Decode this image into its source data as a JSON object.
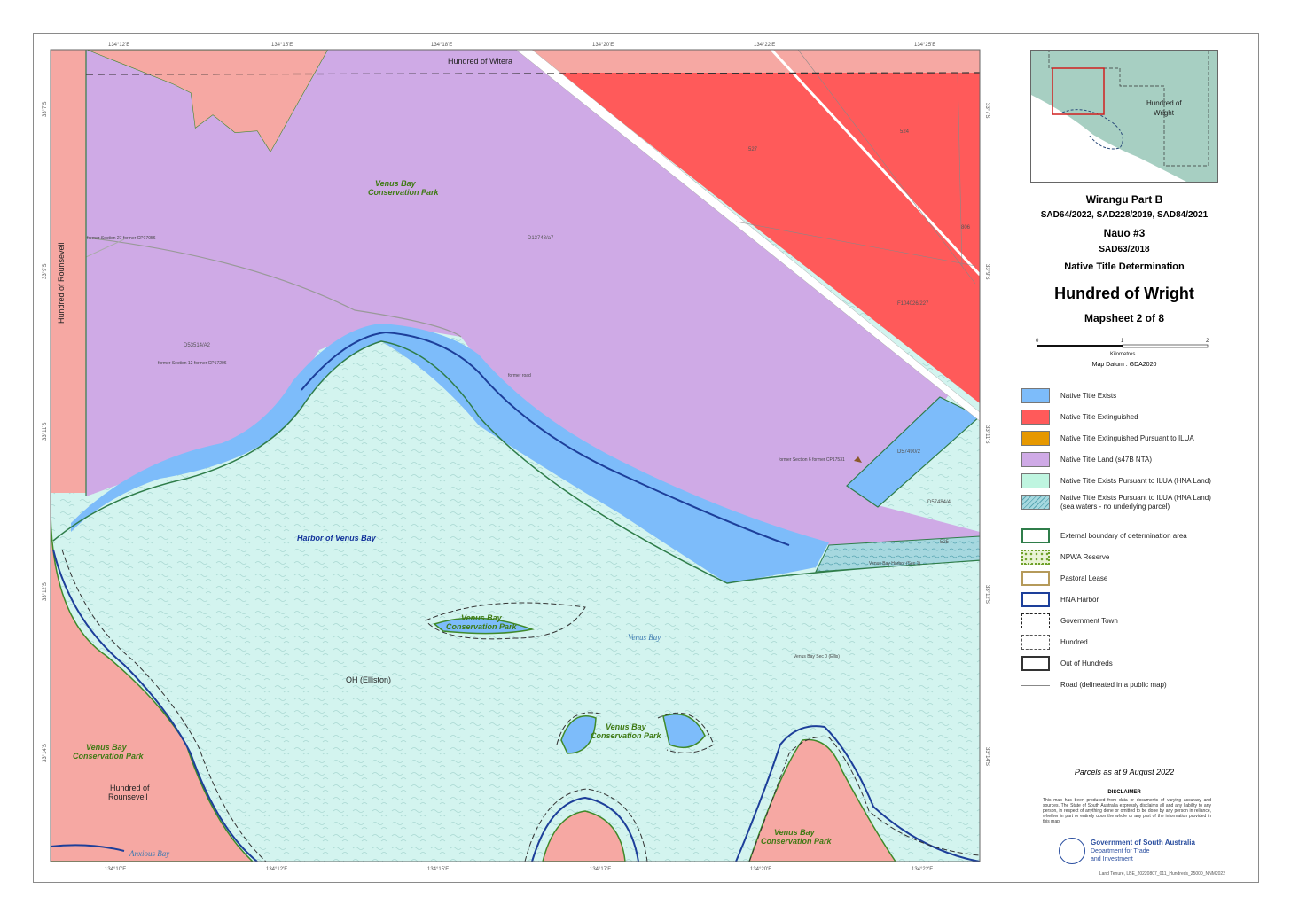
{
  "map": {
    "ticks_top": [
      "134°12'E",
      "134°15'E",
      "134°18'E",
      "134°20'E",
      "134°22'E",
      "134°25'E"
    ],
    "ticks_bottom": [
      "134°10'E",
      "134°12'E",
      "134°15'E",
      "134°17'E",
      "134°20'E",
      "134°22'E"
    ],
    "ticks_left": [
      "33°7'S",
      "33°9'S",
      "33°11'S",
      "33°12'S",
      "33°14'S"
    ],
    "ticks_right": [
      "33°7'S",
      "33°9'S",
      "33°11'S",
      "33°12'S",
      "33°14'S"
    ],
    "labels": {
      "hundred_witera": "Hundred of Witera",
      "hundred_rounsevell_vertical": "Hundred of Rounsevell",
      "hundred_rounsevell_bottom_1": "Hundred of",
      "hundred_rounsevell_bottom_2": "Rounsevell",
      "park_1a": "Venus Bay",
      "park_1b": "Conservation Park",
      "park_2a": "Venus Bay",
      "park_2b": "Conservation Park",
      "park_3a": "Venus Bay",
      "park_3b": "Conservation Park",
      "park_4a": "Venus Bay",
      "park_4b": "Conservation Park",
      "park_5a": "Venus Bay",
      "park_5b": "Conservation Park",
      "harbor": "Harbor of Venus Bay",
      "venus_bay_water": "Venus Bay",
      "anxious_bay": "Anxious Bay",
      "oh_elliston": "OH (Elliston)",
      "parcel_d53514": "D53514/A2",
      "parcel_d53514_note": "former Section 12 former CP17206",
      "parcel_d13748": "D13748/a7",
      "former_section": "former Section 27 former CP17056",
      "parcel_527": "527",
      "parcel_524": "524",
      "parcel_806": "806",
      "parcel_f104026": "F104026/227",
      "parcel_d57490": "D57490/2",
      "parcel_d57484": "D57484/4",
      "parcel_525": "525",
      "road_note": "former road",
      "former_section_right": "former Section 6 former CP17531",
      "venus_bay_sec": "Venus Bay Sec 0 (Ellis)",
      "sea_label": "Venus Bay Harbor (Sec 1)"
    }
  },
  "inset": {
    "label_1": "Hundred of",
    "label_2": "Wright"
  },
  "panel": {
    "title_1": "Wirangu Part B",
    "title_2": "SAD64/2022, SAD228/2019, SAD84/2021",
    "title_3": "Nauo #3",
    "title_4": "SAD63/2018",
    "title_5": "Native Title Determination",
    "main_title": "Hundred of Wright",
    "mapsheet": "Mapsheet 2 of 8",
    "scale_0": "0",
    "scale_1": "1",
    "scale_2": "2",
    "scale_unit": "Kilometres",
    "datum": "Map Datum : GDA2020",
    "parcels_date": "Parcels as at 9 August 2022",
    "disclaimer_title": "DISCLAIMER",
    "disclaimer_text": "This map has been produced from data or documents of varying accuracy and sources. The State of South Australia expressly disclaims all and any liability to any person, in respect of anything done or omitted to be done by any person in reliance, whether in part or entirely upon the whole or any part of the information provided in this map.",
    "gov_1": "Government of South Australia",
    "gov_2": "Department for Trade",
    "gov_3": "and Investment",
    "filename": "Land Tenure, LBE_20220807_011_Hundreds_25000_NNM2022"
  },
  "legend": [
    {
      "label": "Native Title Exists",
      "color": "#7dbcfa",
      "style": "fill"
    },
    {
      "label": "Native Title Extinguished",
      "color": "#ff5a5a",
      "style": "fill"
    },
    {
      "label": "Native Title Extinguished Pursuant to ILUA",
      "color": "#e69800",
      "style": "fill"
    },
    {
      "label": "Native Title Land (s47B NTA)",
      "color": "#cfaae6",
      "style": "fill"
    },
    {
      "label": "Native Title Exists Pursuant to ILUA (HNA Land)",
      "color": "#bff5e0",
      "style": "fill"
    },
    {
      "label": "Native Title Exists Pursuant to ILUA (HNA Land)",
      "label_2": "(sea waters - no underlying parcel)",
      "color": "#a6d8df",
      "style": "pattern"
    },
    {
      "label": "External boundary of determination area",
      "color": "#2f7d4a",
      "style": "outline"
    },
    {
      "label": "NPWA Reserve",
      "color": "#6fa12a",
      "style": "dotted"
    },
    {
      "label": "Pastoral Lease",
      "color": "#b59a5a",
      "style": "outline"
    },
    {
      "label": "HNA Harbor",
      "color": "#1d3f9a",
      "style": "outline"
    },
    {
      "label": "Government Town",
      "color": "#222222",
      "style": "dashed"
    },
    {
      "label": "Hundred",
      "color": "#555555",
      "style": "dashed-long"
    },
    {
      "label": "Out of Hundreds",
      "color": "#333333",
      "style": "outline"
    },
    {
      "label": "Road (delineated in a public map)",
      "color": "#888888",
      "style": "road"
    }
  ],
  "colors": {
    "salmon": "#f6a8a3",
    "red": "#ff5a5a",
    "lavender": "#cfaae6",
    "blue": "#7dbcfa",
    "water": "#d3f4ef",
    "green": "#3f8a2a",
    "harbor": "#1d3f9a"
  }
}
